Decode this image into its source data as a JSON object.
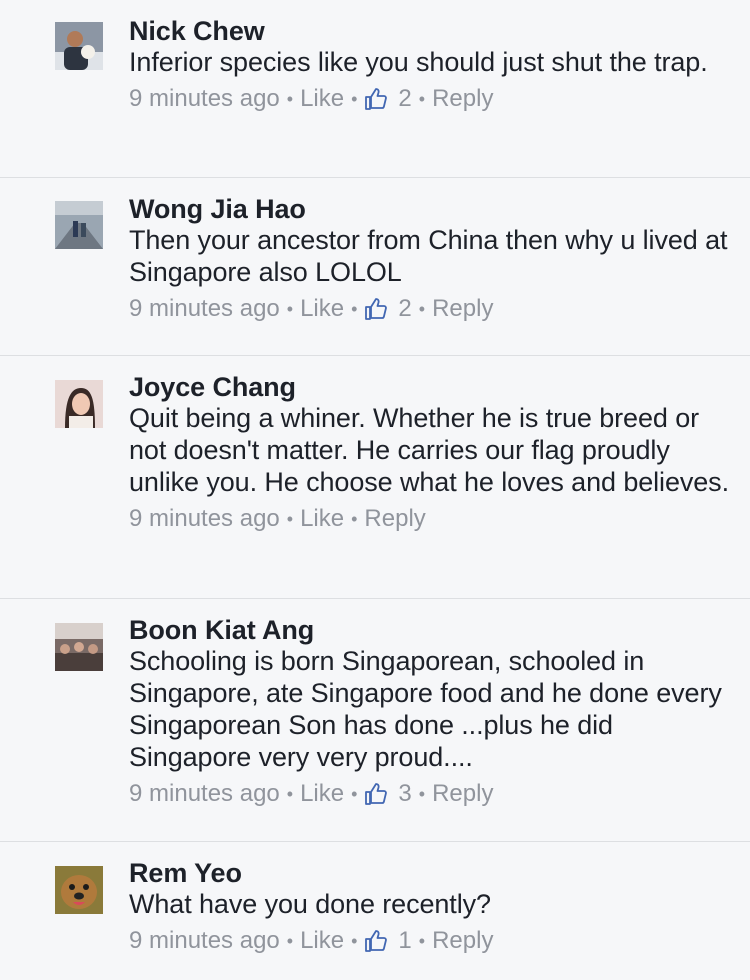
{
  "comments": [
    {
      "author": "Nick Chew",
      "text": "Inferior species like you should just shut the trap.",
      "time": "9 minutes ago",
      "like_label": "Like",
      "likes": "2",
      "reply_label": "Reply"
    },
    {
      "author": "Wong Jia Hao",
      "text": "Then your ancestor from China then why u lived at Singapore also LOLOL",
      "time": "9 minutes ago",
      "like_label": "Like",
      "likes": "2",
      "reply_label": "Reply"
    },
    {
      "author": "Joyce Chang",
      "text": "Quit being a whiner. Whether he is true breed or not doesn't matter. He carries our flag proudly unlike you. He choose what he loves and believes.",
      "time": "9 minutes ago",
      "like_label": "Like",
      "reply_label": "Reply"
    },
    {
      "author": "Boon Kiat Ang",
      "text": "Schooling is born Singaporean, schooled in Singapore, ate Singapore food and he done every Singaporean Son has done ...plus he did Singapore very very proud....",
      "time": "9 minutes ago",
      "like_label": "Like",
      "likes": "3",
      "reply_label": "Reply"
    },
    {
      "author": "Rem Yeo",
      "text": "What have you done recently?",
      "time": "9 minutes ago",
      "like_label": "Like",
      "likes": "1",
      "reply_label": "Reply"
    }
  ],
  "icons": {
    "like_count": "thumbs-up-icon"
  },
  "colors": {
    "background": "#f6f7f9",
    "text": "#1d2129",
    "meta": "#90949c",
    "thumb": "#4267b2",
    "divider": "#dddfe2"
  }
}
